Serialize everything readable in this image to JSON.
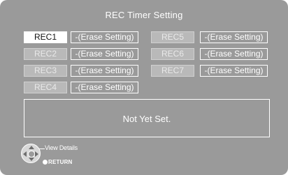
{
  "screen": {
    "title": "REC Timer Setting"
  },
  "left_column": [
    {
      "label": "REC1",
      "erase": "-(Erase Setting)",
      "state": "selected"
    },
    {
      "label": "REC2",
      "erase": "-(Erase Setting)",
      "state": "inactive"
    },
    {
      "label": "REC3",
      "erase": "-(Erase Setting)",
      "state": "inactive"
    },
    {
      "label": "REC4",
      "erase": "-(Erase Setting)",
      "state": "inactive"
    }
  ],
  "right_column": [
    {
      "label": "REC5",
      "erase": "-(Erase Setting)",
      "state": "inactive"
    },
    {
      "label": "REC6",
      "erase": "-(Erase Setting)",
      "state": "inactive"
    },
    {
      "label": "REC7",
      "erase": "-(Erase Setting)",
      "state": "inactive"
    }
  ],
  "info_panel": {
    "message": "Not Yet Set."
  },
  "footer": {
    "view_details": "View Details",
    "return": "RETURN"
  },
  "colors": {
    "background": "#9a9a9a",
    "selected_button_bg": "#ffffff",
    "inactive_button_bg": "#b9b9b9",
    "text": "#ffffff"
  }
}
